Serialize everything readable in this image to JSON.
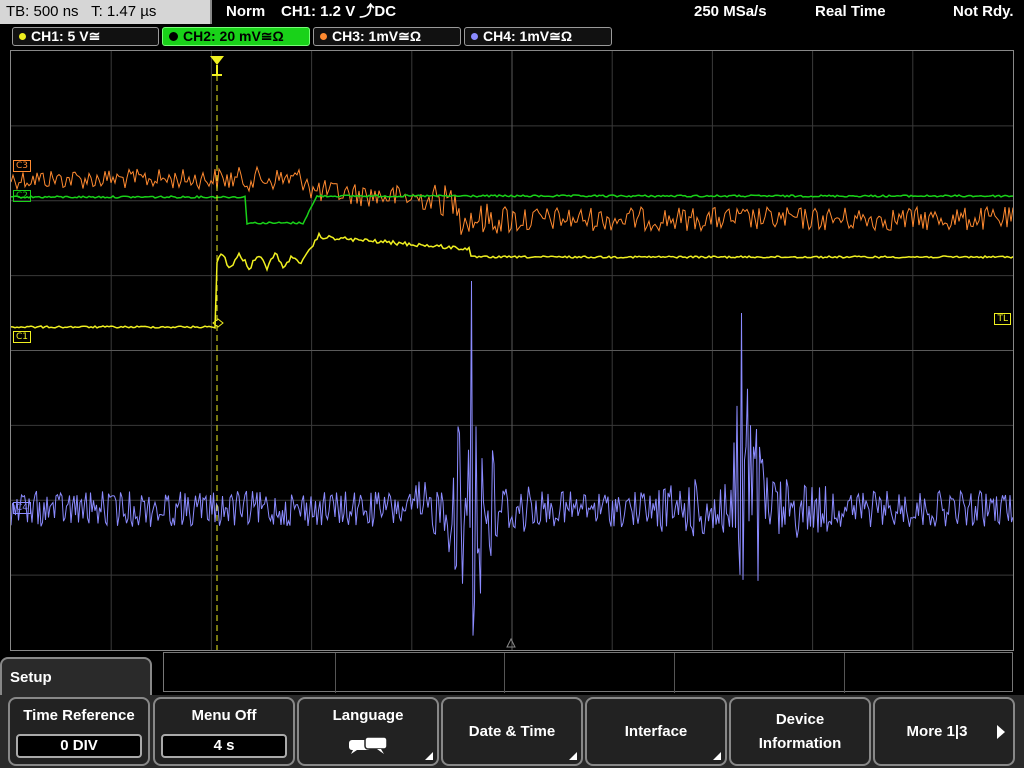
{
  "header": {
    "timebase": "TB: 500 ns",
    "trigger_time": "T: 1.47 µs",
    "mode": "Norm",
    "trigger_setting": "CH1: 1.2 V ⤴DC",
    "sample_rate": "250 MSa/s",
    "acq_mode": "Real Time",
    "status": "Not Rdy."
  },
  "channels": [
    {
      "label": "CH1: 5 V≅",
      "color": "#f0f020",
      "active": false
    },
    {
      "label": "CH2: 20 mV≅Ω",
      "color": "#19d219",
      "active": true
    },
    {
      "label": "CH3: 1mV≅Ω",
      "color": "#ff8a30",
      "active": false
    },
    {
      "label": "CH4: 1mV≅Ω",
      "color": "#8b8bff",
      "active": false
    }
  ],
  "markers": {
    "c1": "C1",
    "c2": "C2",
    "c3": "C3",
    "c4": "C4",
    "tl": "TL"
  },
  "menu": {
    "title": "Setup",
    "softkeys": [
      {
        "label": "Time Reference",
        "value": "0 DIV"
      },
      {
        "label": "Menu Off",
        "value": "4 s"
      },
      {
        "label": "Language",
        "icon": "speech-bubbles-icon"
      },
      {
        "label": "Date & Time"
      },
      {
        "label": "Interface"
      },
      {
        "label": "Device Information"
      },
      {
        "label": "More 1|3"
      }
    ]
  },
  "colors": {
    "ch1": "#f0f020",
    "ch2": "#19d219",
    "ch3": "#ff8a30",
    "ch4": "#8b8bff",
    "grid": "#3a3a3a"
  }
}
